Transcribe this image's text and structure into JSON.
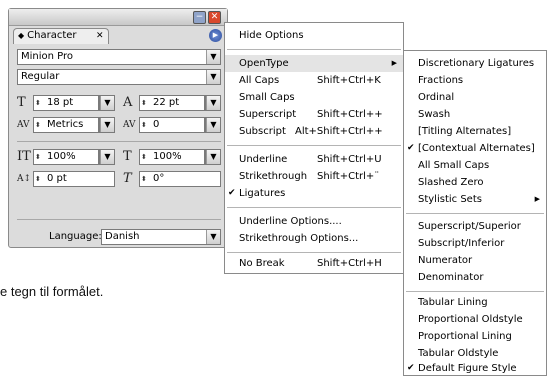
{
  "panel": {
    "tab_label": "Character",
    "font_family": "Minion Pro",
    "font_style": "Regular",
    "font_size": "18 pt",
    "leading": "22 pt",
    "kerning": "Metrics",
    "tracking": "0",
    "vertical_scale": "100%",
    "horizontal_scale": "100%",
    "baseline_shift": "0 pt",
    "skew": "0°",
    "language_label": "Language:",
    "language": "Danish"
  },
  "menu": {
    "items": [
      {
        "label": "Hide Options",
        "shortcut": ""
      },
      {
        "label": "OpenType",
        "shortcut": ""
      },
      {
        "label": "All Caps",
        "shortcut": "Shift+Ctrl+K"
      },
      {
        "label": "Small Caps",
        "shortcut": ""
      },
      {
        "label": "Superscript",
        "shortcut": "Shift+Ctrl++"
      },
      {
        "label": "Subscript",
        "shortcut": "Alt+Shift+Ctrl++"
      },
      {
        "label": "Underline",
        "shortcut": "Shift+Ctrl+U"
      },
      {
        "label": "Strikethrough",
        "shortcut": "Shift+Ctrl+¨"
      },
      {
        "label": "Ligatures",
        "shortcut": ""
      },
      {
        "label": "Underline Options....",
        "shortcut": ""
      },
      {
        "label": "Strikethrough Options...",
        "shortcut": ""
      },
      {
        "label": "No Break",
        "shortcut": "Shift+Ctrl+H"
      }
    ]
  },
  "submenu": {
    "items": [
      "Discretionary Ligatures",
      "Fractions",
      "Ordinal",
      "Swash",
      "[Titling Alternates]",
      "[Contextual Alternates]",
      "All Small Caps",
      "Slashed Zero",
      "Stylistic Sets",
      "Superscript/Superior",
      "Subscript/Inferior",
      "Numerator",
      "Denominator",
      "Tabular Lining",
      "Proportional Oldstyle",
      "Proportional Lining",
      "Tabular Oldstyle",
      "Default Figure Style"
    ]
  },
  "background_text": "e tegn til formålet.",
  "colors": {
    "close_button": "#d9492c",
    "panel_bg": "#dcdcdc",
    "highlight": "#e4e4e4"
  }
}
